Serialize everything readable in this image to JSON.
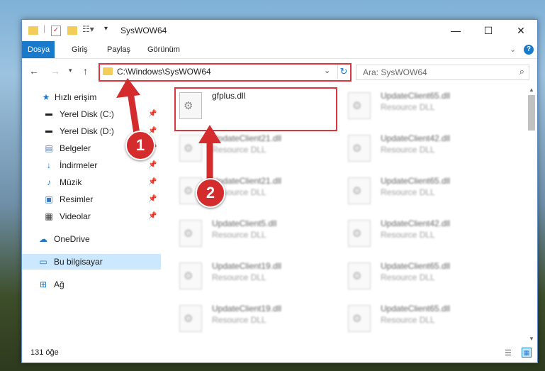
{
  "window": {
    "title": "SysWOW64",
    "controls": {
      "minimize": "—",
      "maximize": "☐",
      "close": "✕"
    }
  },
  "ribbon": {
    "tabs": [
      {
        "label": "Dosya",
        "active": true
      },
      {
        "label": "Giriş"
      },
      {
        "label": "Paylaş"
      },
      {
        "label": "Görünüm"
      }
    ],
    "expand_icon": "chevron-down-icon",
    "help_icon": "help-icon"
  },
  "address": {
    "path": "C:\\Windows\\SysWOW64",
    "search_placeholder": "Ara: SysWOW64"
  },
  "sidebar": {
    "items": [
      {
        "label": "Hızlı erişim",
        "icon": "star-icon",
        "pinned": false
      },
      {
        "label": "Yerel Disk (C:)",
        "icon": "drive-icon",
        "pinned": true
      },
      {
        "label": "Yerel Disk (D:)",
        "icon": "drive-icon",
        "pinned": true
      },
      {
        "label": "Belgeler",
        "icon": "document-icon",
        "pinned": true
      },
      {
        "label": "İndirmeler",
        "icon": "download-icon",
        "pinned": true
      },
      {
        "label": "Müzik",
        "icon": "music-icon",
        "pinned": true
      },
      {
        "label": "Resimler",
        "icon": "pictures-icon",
        "pinned": true
      },
      {
        "label": "Videolar",
        "icon": "video-icon",
        "pinned": true
      },
      {
        "label": "OneDrive",
        "icon": "cloud-icon",
        "pinned": false
      },
      {
        "label": "Bu bilgisayar",
        "icon": "computer-icon",
        "pinned": false,
        "selected": true
      },
      {
        "label": "Ağ",
        "icon": "network-icon",
        "pinned": false
      }
    ]
  },
  "files": {
    "left_column": [
      {
        "name": "gfplus.dll",
        "type": ""
      },
      {
        "name": "UpdateClient21.dll",
        "type": "Resource DLL"
      },
      {
        "name": "UpdateClient21.dll",
        "type": "Resource DLL"
      },
      {
        "name": "UpdateClient5.dll",
        "type": "Resource DLL"
      },
      {
        "name": "UpdateClient19.dll",
        "type": "Resource DLL"
      },
      {
        "name": "UpdateClient19.dll",
        "type": "Resource DLL"
      }
    ],
    "right_column": [
      {
        "name": "UpdateClient65.dll",
        "type": "Resource DLL"
      },
      {
        "name": "UpdateClient42.dll",
        "type": "Resource DLL"
      },
      {
        "name": "UpdateClient65.dll",
        "type": "Resource DLL"
      },
      {
        "name": "UpdateClient42.dll",
        "type": "Resource DLL"
      },
      {
        "name": "UpdateClient65.dll",
        "type": "Resource DLL"
      },
      {
        "name": "UpdateClient65.dll",
        "type": "Resource DLL"
      }
    ]
  },
  "annotations": {
    "badge1": "1",
    "badge2": "2",
    "color": "#d42c2c"
  },
  "status": {
    "count": "131 öğe"
  }
}
